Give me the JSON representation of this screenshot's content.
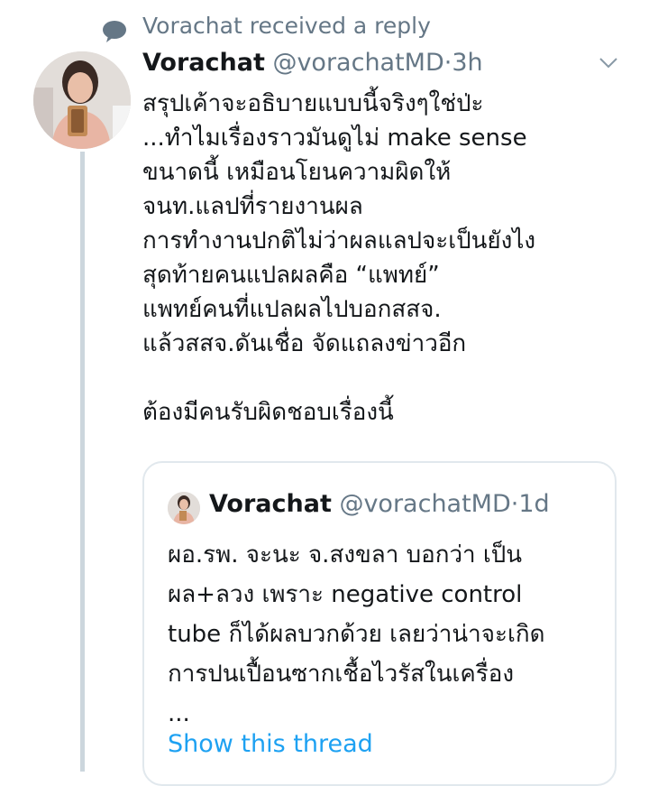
{
  "context": {
    "icon": "speech-bubble-icon",
    "text": "Vorachat received a reply"
  },
  "tweet": {
    "name": "Vorachat",
    "handle": "@vorachatMD",
    "separator": "·",
    "time": "3h",
    "avatar_icon": "user-avatar",
    "menu_icon": "chevron-down-icon",
    "lines": [
      "สรุปเค้าจะอธิบายแบบนี้จริงๆใช่ป่ะ",
      "...ทำไมเรื่องราวมันดูไม่ make sense",
      "ขนาดนี้ เหมือนโยนความผิดให้",
      "จนท.แลปที่รายงานผล",
      "การทำงานปกติไม่ว่าผลแลปจะเป็นยังไง",
      "สุดท้ายคนแปลผลคือ “แพทย์”",
      "แพทย์คนที่แปลผลไปบอกสสจ.",
      "แล้วสสจ.ดันเชื่อ จัดแถลงข่าวอีก",
      "",
      "ต้องมีคนรับผิดชอบเรื่องนี้"
    ]
  },
  "quote": {
    "name": "Vorachat",
    "handle": "@vorachatMD",
    "separator": "·",
    "time": "1d",
    "lines": [
      "ผอ.รพ. จะนะ จ.สงขลา บอกว่า เป็น",
      "ผล+ลวง เพราะ negative control",
      "tube ก็ได้ผลบวกด้วย เลยว่าน่าจะเกิด",
      "การปนเปื้อนซากเชื้อไวรัสในเครื่อง",
      "..."
    ],
    "show_thread": "Show this thread"
  },
  "colors": {
    "accent": "#1da1f2",
    "secondary_text": "#657786",
    "border": "#e1e8ed",
    "thread_line": "#ccd6dd"
  }
}
